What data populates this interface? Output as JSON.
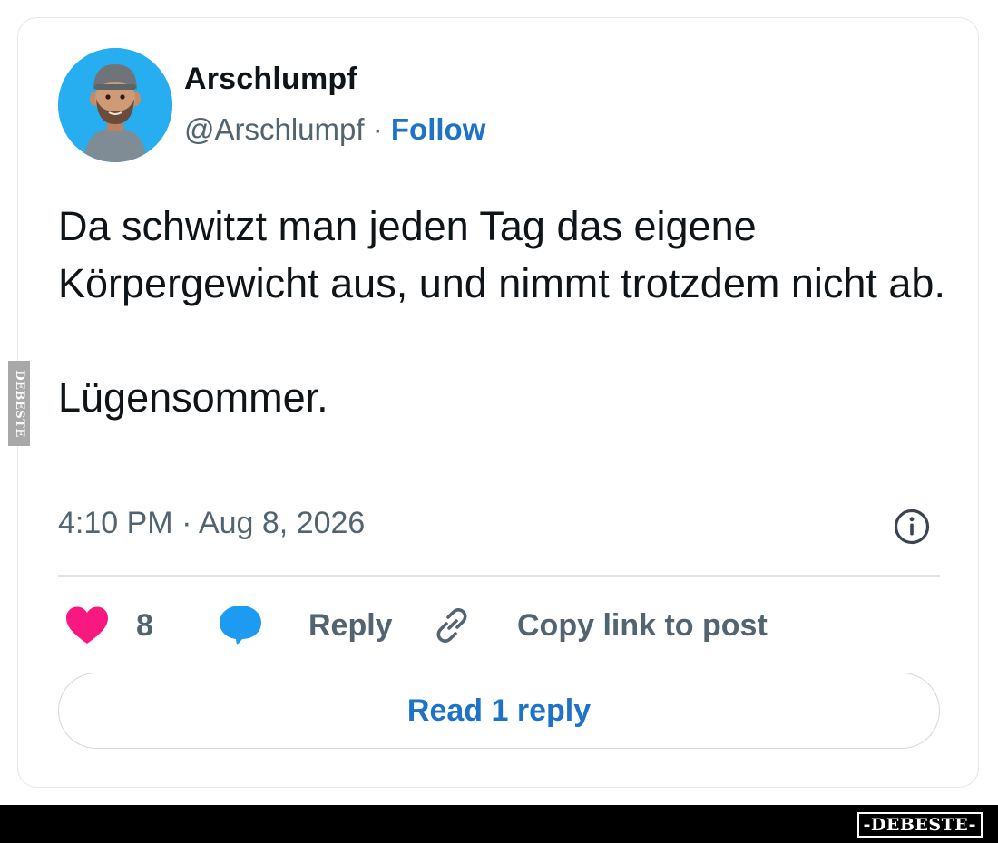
{
  "author": {
    "name": "Arschlumpf",
    "handle": "@Arschlumpf",
    "separator": " · ",
    "follow_label": "Follow"
  },
  "tweet": {
    "paragraphs": [
      "Da schwitzt man jeden Tag das eigene Körpergewicht aus, und nimmt trotzdem nicht ab.",
      "Lügensommer."
    ],
    "timestamp": "4:10 PM · Aug 8, 2026"
  },
  "actions": {
    "like_count": "8",
    "reply_label": "Reply",
    "copy_label": "Copy link to post"
  },
  "read_replies_label": "Read 1 reply",
  "watermark": {
    "side_text": "DEBESTE",
    "bottom_text": "-DEBESTE-"
  },
  "colors": {
    "heart": "#f91880",
    "reply_bubble": "#1d9bf0",
    "link_blue": "#1d72c9",
    "muted_text": "#536471",
    "avatar_bg": "#27aef0"
  },
  "icons": [
    "heart-icon",
    "reply-bubble-icon",
    "link-icon",
    "info-icon"
  ]
}
